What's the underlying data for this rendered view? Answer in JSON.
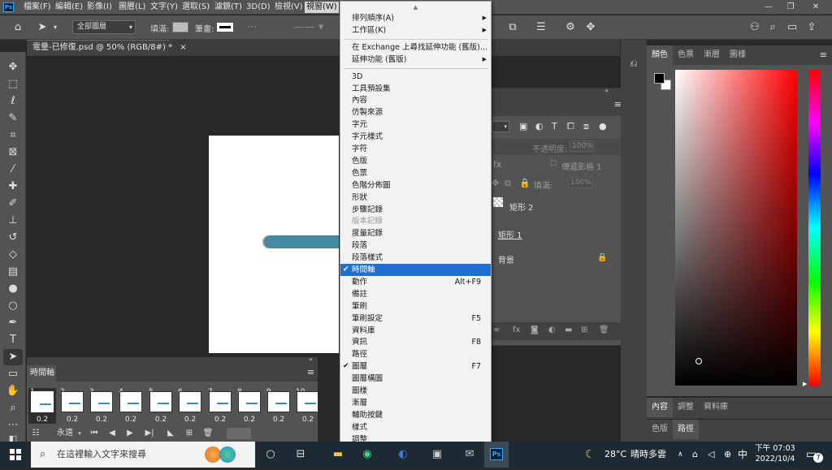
{
  "app": {
    "logo": "Ps",
    "menu": [
      "檔案(F)",
      "編輯(E)",
      "影像(I)",
      "圖層(L)",
      "文字(Y)",
      "選取(S)",
      "濾鏡(T)",
      "3D(D)",
      "檢視(V)",
      "視窗(W)"
    ],
    "active_menu": "視窗(W)"
  },
  "options_bar": {
    "layer_select": "全部圖層",
    "fill_label": "填滿:",
    "stroke_label": "筆畫:"
  },
  "document": {
    "tab_title": "電量-已修復.psd @ 50% (RGB/8#) *",
    "close": "×",
    "bar_color": "#468aa1"
  },
  "timeline": {
    "title": "時間軸",
    "frames": [
      {
        "n": "1",
        "delay": "0.2"
      },
      {
        "n": "2",
        "delay": "0.2"
      },
      {
        "n": "3",
        "delay": "0.2"
      },
      {
        "n": "4",
        "delay": "0.2"
      },
      {
        "n": "5",
        "delay": "0.2"
      },
      {
        "n": "6",
        "delay": "0.2"
      },
      {
        "n": "7",
        "delay": "0.2"
      },
      {
        "n": "8",
        "delay": "0.2"
      },
      {
        "n": "9",
        "delay": "0.2"
      },
      {
        "n": "10",
        "delay": "0.2"
      }
    ],
    "loop": "永遠"
  },
  "layers": {
    "opacity_label": "不透明度:",
    "opacity_value": "100%",
    "fill_label": "填滿:",
    "fill_value": "100%",
    "propagate": "傳遞影格 1",
    "items": [
      "矩形 2",
      "矩形 1",
      "背景"
    ]
  },
  "color_panel": {
    "tabs": [
      "顏色",
      "色票",
      "漸層",
      "圖樣"
    ],
    "bottom_tabs_1": [
      "內容",
      "調整",
      "資料庫"
    ],
    "bottom_tabs_2": [
      "色版",
      "路徑"
    ]
  },
  "window_menu": {
    "items": [
      {
        "label": "排列順序(A)",
        "submenu": true
      },
      {
        "label": "工作區(K)",
        "submenu": true
      },
      {
        "sep": true
      },
      {
        "label": "在 Exchange 上尋找延伸功能 (舊版)..."
      },
      {
        "label": "延伸功能 (舊版)",
        "submenu": true
      },
      {
        "sep": true
      },
      {
        "label": "3D"
      },
      {
        "label": "工具預設集"
      },
      {
        "label": "內容"
      },
      {
        "label": "仿製來源"
      },
      {
        "label": "字元"
      },
      {
        "label": "字元樣式"
      },
      {
        "label": "字符"
      },
      {
        "label": "色版"
      },
      {
        "label": "色票"
      },
      {
        "label": "色階分佈圖"
      },
      {
        "label": "形狀"
      },
      {
        "label": "步驟記錄"
      },
      {
        "label": "版本記錄",
        "disabled": true
      },
      {
        "label": "度量記錄"
      },
      {
        "label": "段落"
      },
      {
        "label": "段落樣式"
      },
      {
        "label": "時間軸",
        "checked": true,
        "highlighted": true
      },
      {
        "label": "動作",
        "shortcut": "Alt+F9"
      },
      {
        "label": "備註"
      },
      {
        "label": "筆刷"
      },
      {
        "label": "筆刷設定",
        "shortcut": "F5"
      },
      {
        "label": "資料庫"
      },
      {
        "label": "資訊",
        "shortcut": "F8"
      },
      {
        "label": "路徑"
      },
      {
        "label": "圖層",
        "checked": true,
        "shortcut": "F7"
      },
      {
        "label": "圖層構圖"
      },
      {
        "label": "圖樣"
      },
      {
        "label": "漸層"
      },
      {
        "label": "輔助按鍵"
      },
      {
        "label": "樣式"
      },
      {
        "label": "調整"
      }
    ]
  },
  "taskbar": {
    "search_placeholder": "在這裡輸入文字來搜尋",
    "weather_temp": "28°C",
    "weather_desc": "晴時多雲",
    "ime": "中",
    "time": "下午 07:03",
    "date": "2022/10/4",
    "notification_count": "7",
    "ps_label": "Ps"
  }
}
